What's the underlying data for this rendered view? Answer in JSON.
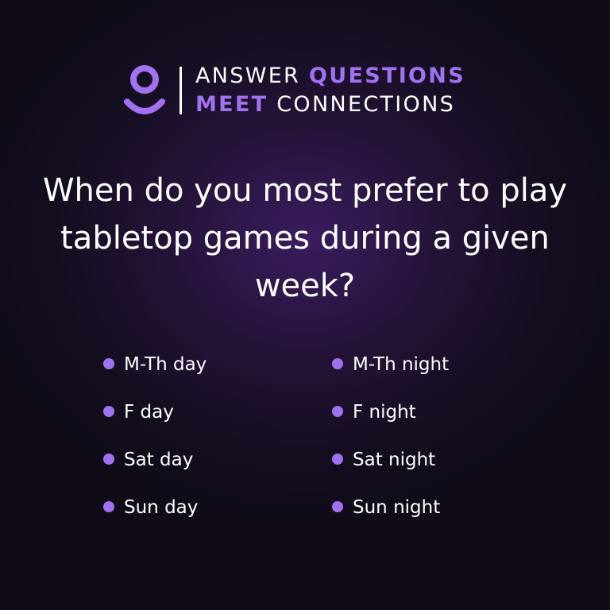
{
  "brand": {
    "line1_word1": "ANSWER",
    "line1_word2": "QUESTIONS",
    "line2_word1": "MEET",
    "line2_word2": "CONNECTIONS",
    "logo_icon": "person-icon",
    "accent_color": "#a071f0"
  },
  "question": "When do you most prefer to play tabletop games during a given week?",
  "options_left": [
    "M-Th day",
    "F day",
    "Sat day",
    "Sun day"
  ],
  "options_right": [
    "M-Th night",
    "F night",
    "Sat night",
    "Sun night"
  ]
}
